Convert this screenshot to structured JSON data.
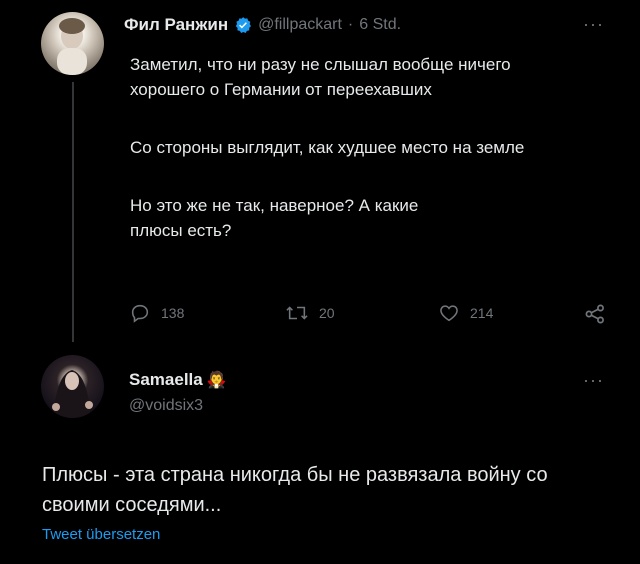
{
  "tweet": {
    "author_name": "Фил Ранжин",
    "handle": "@fillpackart",
    "separator": "·",
    "time": "6 Std.",
    "paragraphs": [
      "Заметил, что ни разу не слышал вообще ничего хорошего о Германии от переехавших",
      "Со стороны выглядит, как худшее место на земле",
      "Но это же не так, наверное? А какие плюсы есть?"
    ],
    "replies": "138",
    "retweets": "20",
    "likes": "214"
  },
  "reply": {
    "author_name": "Samaella",
    "author_emoji": "🧛",
    "handle": "@voidsix3",
    "text": "Плюсы - эта страна никогда бы не развязала войну со своими соседями...",
    "translate_link": "Tweet übersetzen"
  },
  "more_symbol": "···",
  "colors": {
    "background": "#000000",
    "text": "#e7e9ea",
    "secondary": "#71767b",
    "link": "#1d9bf0",
    "verified": "#1d9bf0"
  },
  "icons": [
    "reply-icon",
    "retweet-icon",
    "like-icon",
    "share-icon",
    "verified-badge-icon",
    "more-icon"
  ]
}
